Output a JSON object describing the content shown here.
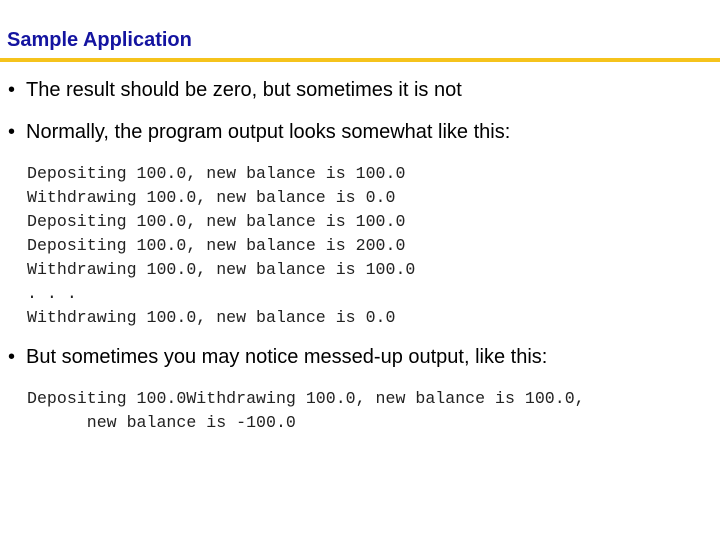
{
  "slide": {
    "title": "Sample Application",
    "accent_color": "#f5c31c",
    "title_color": "#1414a0"
  },
  "bullets": [
    {
      "marker": "•",
      "text": "The result should be zero, but sometimes it is not"
    },
    {
      "marker": "•",
      "text": "Normally, the program output looks somewhat like this:"
    },
    {
      "marker": "•",
      "text": "But sometimes you may notice messed-up output, like this:"
    }
  ],
  "normal_output": [
    "Depositing 100.0, new balance is 100.0",
    "Withdrawing 100.0, new balance is 0.0",
    "Depositing 100.0, new balance is 100.0",
    "Depositing 100.0, new balance is 200.0",
    "Withdrawing 100.0, new balance is 100.0",
    ". . .",
    "Withdrawing 100.0, new balance is 0.0"
  ],
  "messed_output": [
    "Depositing 100.0Withdrawing 100.0, new balance is 100.0,",
    "      new balance is -100.0"
  ]
}
